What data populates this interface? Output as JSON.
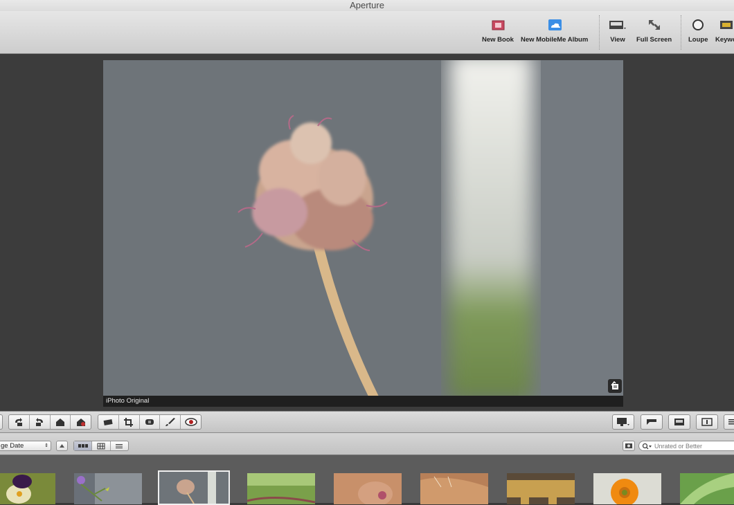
{
  "app": {
    "title": "Aperture"
  },
  "toolbar": {
    "new_book": "New Book",
    "new_mobileme_album": "New MobileMe Album",
    "view": "View",
    "full_screen": "Full Screen",
    "loupe": "Loupe",
    "keywords": "Keywo"
  },
  "viewer": {
    "caption": "iPhoto Original"
  },
  "strip": {
    "sort_label": "ge Date",
    "filter_placeholder": "Unrated or Better"
  },
  "colors": {
    "accent_photo_bg": "#6f757b",
    "toolbar_bg": "#d8d8d8",
    "viewer_bg": "#3c3c3c",
    "filmstrip_bg": "#5c5c5c"
  }
}
